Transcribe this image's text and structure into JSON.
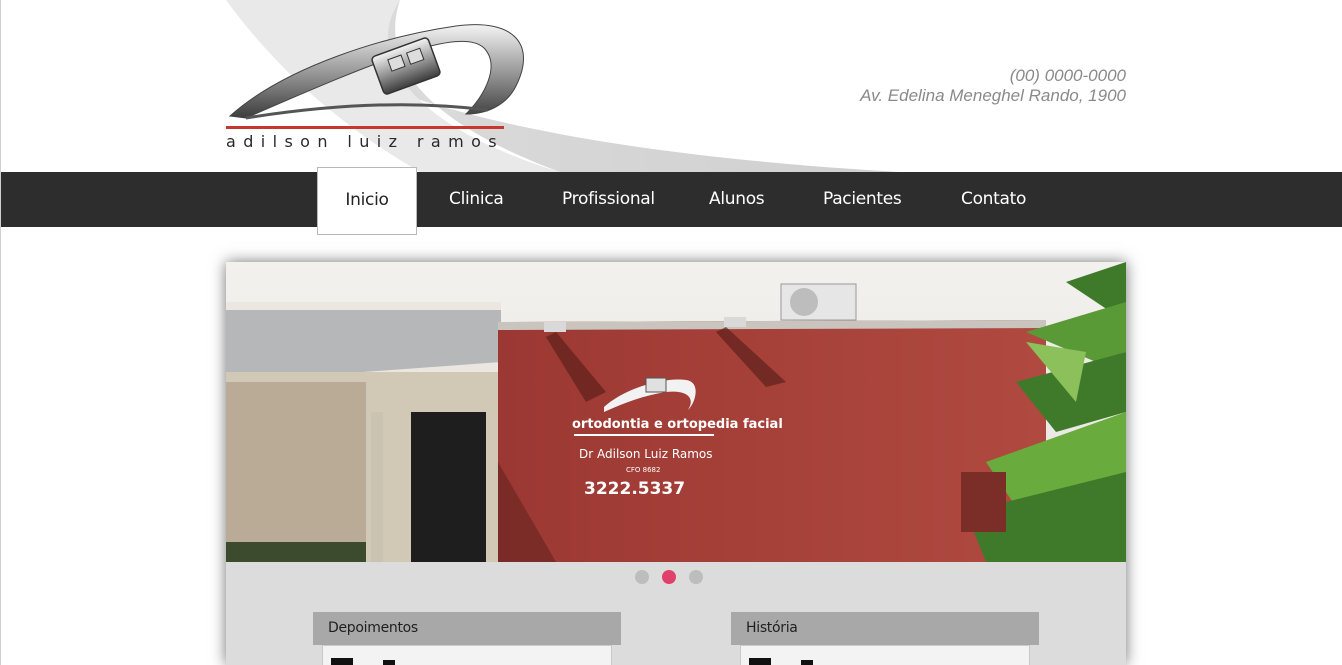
{
  "header": {
    "logo_name": "adilson luiz ramos",
    "phone": "(00) 0000-0000",
    "address": "Av. Edelina Meneghel Rando, 1900"
  },
  "nav": {
    "items": [
      {
        "label": "Inicio",
        "active": true
      },
      {
        "label": "Clinica",
        "active": false
      },
      {
        "label": "Profissional",
        "active": false
      },
      {
        "label": "Alunos",
        "active": false
      },
      {
        "label": "Pacientes",
        "active": false
      },
      {
        "label": "Contato",
        "active": false
      }
    ]
  },
  "slider": {
    "sign_title": "ortodontia e ortopedia facial",
    "sign_name": "Dr Adilson Luiz Ramos",
    "sign_cro": "CFO 8682",
    "sign_phone": "3222.5337",
    "slide_count": 3,
    "active_slide": 2
  },
  "boxes": [
    {
      "title": "Depoimentos"
    },
    {
      "title": "História"
    }
  ],
  "colors": {
    "nav_bg": "#2d2d2d",
    "accent_dot": "#e0416a",
    "wall_red": "#a33c37",
    "logo_red": "#c8372d"
  }
}
